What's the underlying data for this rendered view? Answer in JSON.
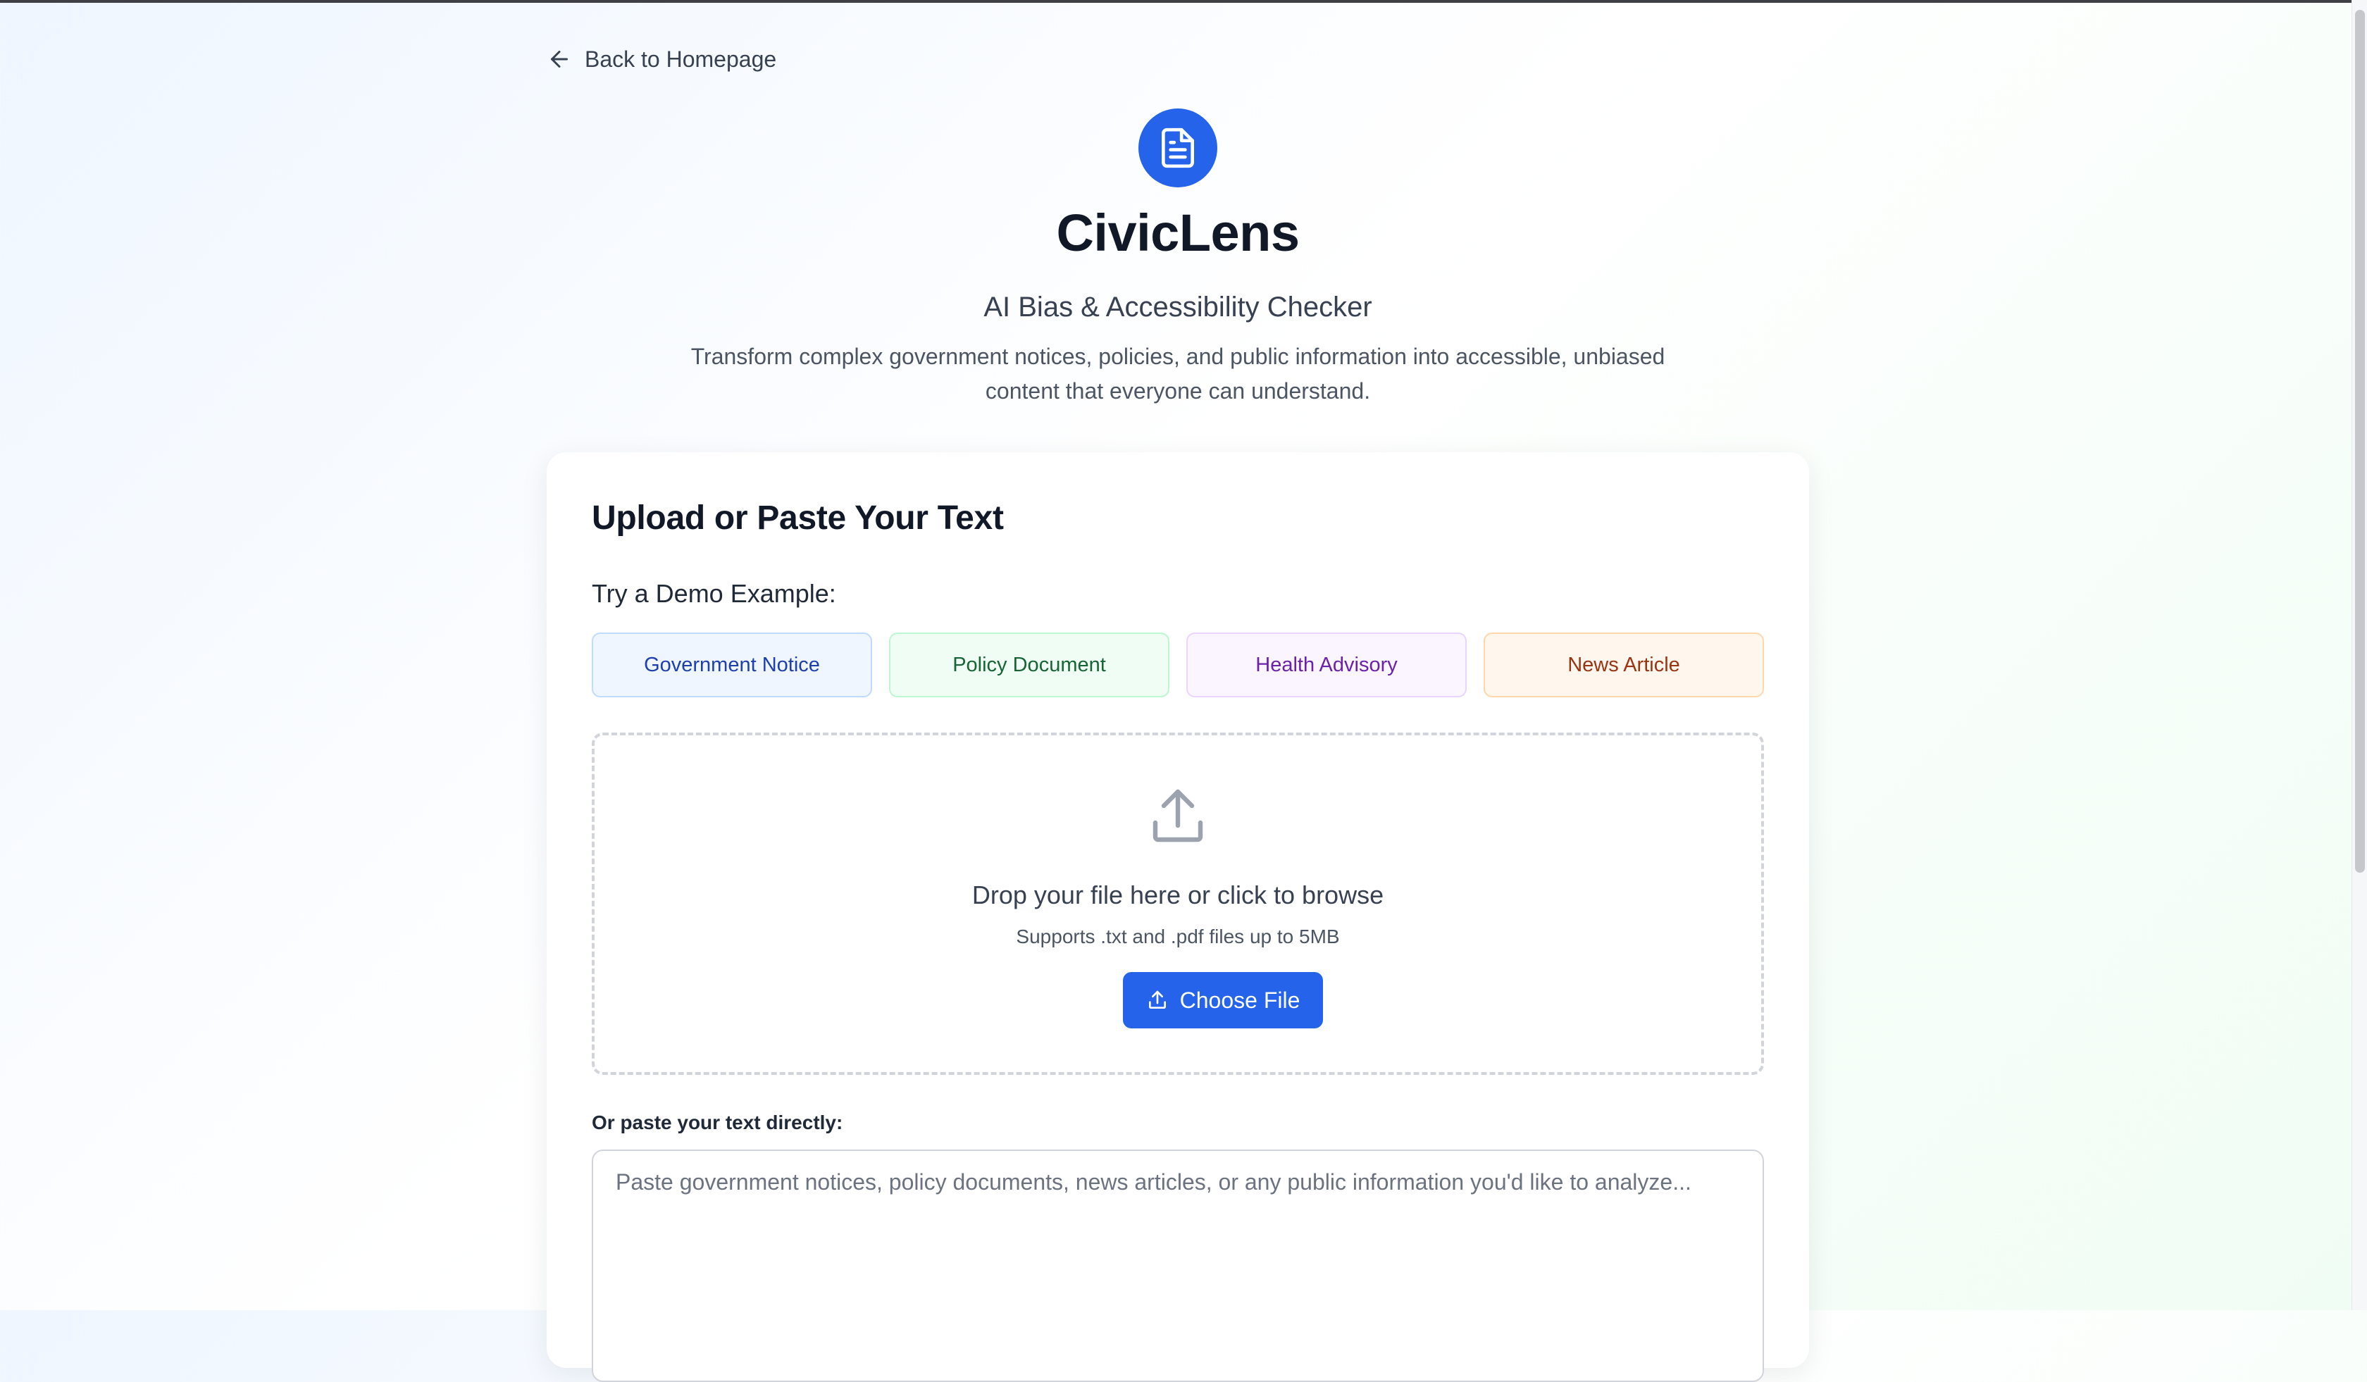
{
  "nav": {
    "back_label": "Back to Homepage"
  },
  "header": {
    "title": "CivicLens",
    "subtitle": "AI Bias & Accessibility Checker",
    "description": "Transform complex government notices, policies, and public information into accessible, unbiased content that everyone can understand."
  },
  "card": {
    "title": "Upload or Paste Your Text",
    "demo_label": "Try a Demo Example:",
    "demo_examples": [
      "Government Notice",
      "Policy Document",
      "Health Advisory",
      "News Article"
    ],
    "dropzone": {
      "title": "Drop your file here or click to browse",
      "hint": "Supports .txt and .pdf files up to 5MB",
      "button_label": "Choose File"
    },
    "paste": {
      "label": "Or paste your text directly:",
      "placeholder": "Paste government notices, policy documents, news articles, or any public information you'd like to analyze...",
      "value": ""
    }
  },
  "icons": {
    "back": "arrow-left-icon",
    "logo": "document-icon",
    "dropzone": "upload-icon",
    "button": "upload-icon"
  },
  "colors": {
    "primary": "#2563eb",
    "demo_blue": "#1e40af",
    "demo_green": "#166534",
    "demo_purple": "#6b21a8",
    "demo_orange": "#9a3412"
  }
}
